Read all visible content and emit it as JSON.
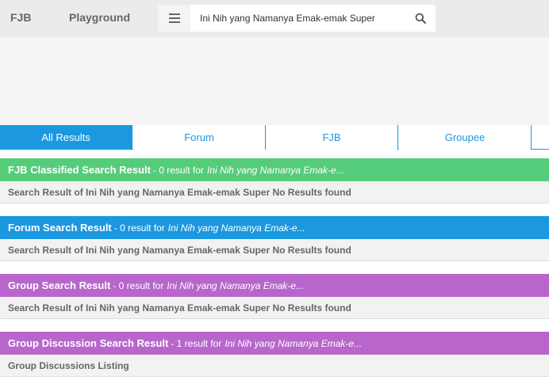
{
  "nav": {
    "fjb": "FJB",
    "playground": "Playground"
  },
  "search": {
    "value": "Ini Nih yang Namanya Emak-emak Super"
  },
  "tabs": [
    "All Results",
    "Forum",
    "FJB",
    "Groupee"
  ],
  "sections": [
    {
      "title": "FJB Classified Search Result",
      "count": "- 0 result for",
      "query": "Ini Nih yang Namanya Emak-e...",
      "body": "Search Result of Ini Nih yang Namanya Emak-emak Super No Results found",
      "color": "#55cc7a"
    },
    {
      "title": "Forum Search Result",
      "count": "- 0 result for",
      "query": "Ini Nih yang Namanya Emak-e...",
      "body": "Search Result of Ini Nih yang Namanya Emak-emak Super No Results found",
      "color": "#1b98e0"
    },
    {
      "title": "Group Search Result",
      "count": "- 0 result for",
      "query": "Ini Nih yang Namanya Emak-e...",
      "body": "Search Result of Ini Nih yang Namanya Emak-emak Super No Results found",
      "color": "#b866cc"
    },
    {
      "title": "Group Discussion Search Result",
      "count": "- 1 result for",
      "query": "Ini Nih yang Namanya Emak-e...",
      "body": "Group Discussions Listing",
      "color": "#b866cc"
    }
  ],
  "icons": {
    "menu": "hamburger-menu-icon",
    "search": "search-icon"
  }
}
